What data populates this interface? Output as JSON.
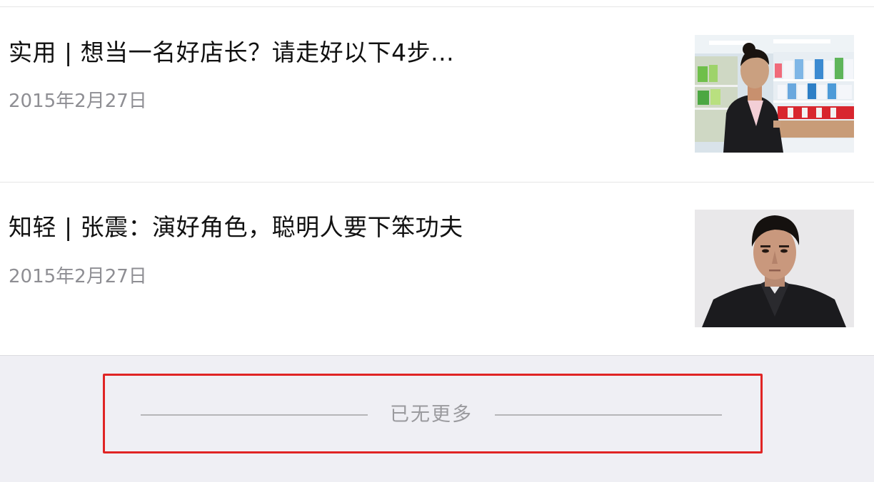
{
  "articles": [
    {
      "title": "实用 | 想当一名好店长？请走好以下4步...",
      "date": "2015年2月27日",
      "thumbnail": "photo of a woman in a black blazer in a supermarket aisle"
    },
    {
      "title": "知轻 | 张震：演好角色，聪明人要下笨功夫",
      "date": "2015年2月27日",
      "thumbnail": "portrait of a man in a dark jacket"
    }
  ],
  "footer": {
    "end_text": "已无更多",
    "highlight_color": "#e02424"
  }
}
